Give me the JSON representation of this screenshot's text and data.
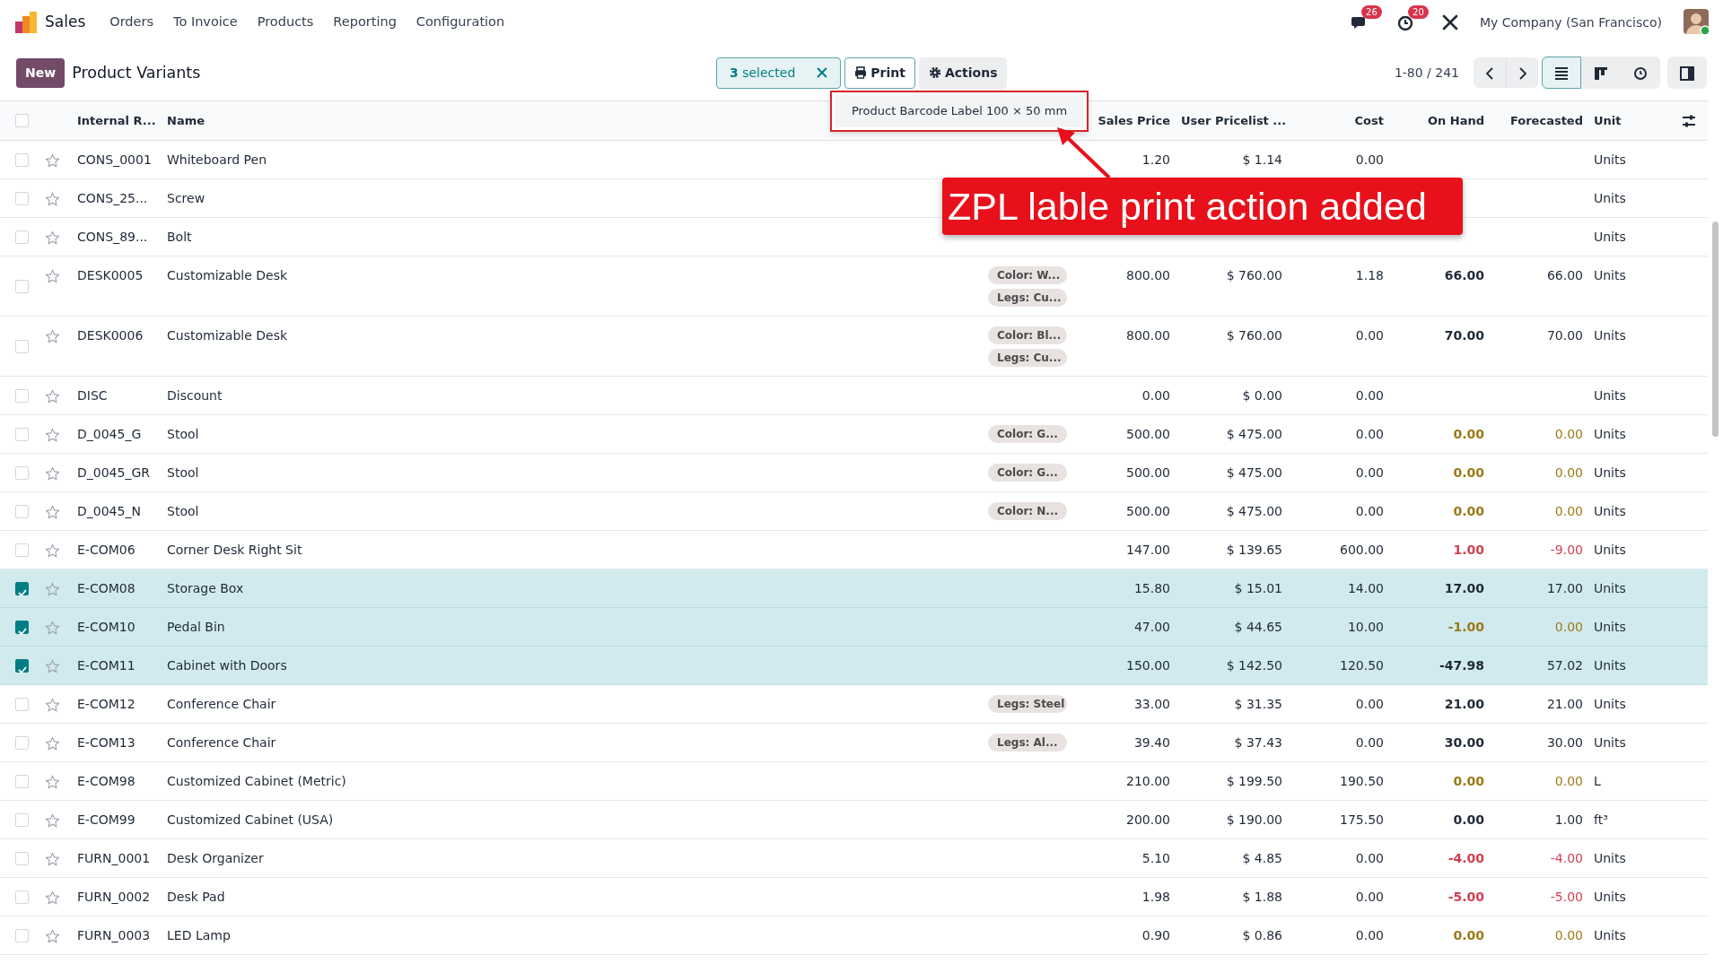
{
  "app": {
    "name": "Sales",
    "menu": [
      "Orders",
      "To Invoice",
      "Products",
      "Reporting",
      "Configuration"
    ]
  },
  "systray": {
    "messages_count": "26",
    "activities_count": "20",
    "company": "My Company (San Francisco)"
  },
  "control_panel": {
    "new_button": "New",
    "title": "Product Variants",
    "selection": "**3** selected",
    "print_button": "Print",
    "actions_button": "Actions",
    "pager": "1-80 / 241",
    "views": [
      {
        "kind": "list",
        "selected": true
      },
      {
        "kind": "kanban",
        "selected": false
      },
      {
        "kind": "activity",
        "selected": false
      }
    ]
  },
  "print_menu": {
    "items": [
      "Product Barcode Label 100 × 50 mm"
    ]
  },
  "annotation": {
    "text": "ZPL lable print action added"
  },
  "table": {
    "all_selected": false,
    "columns": [
      "Internal R...",
      "Name",
      "Sales Price",
      "User Pricelist ...",
      "Cost",
      "On Hand",
      "Forecasted",
      "Unit"
    ],
    "rows": [
      {
        "ref": "CONS_0001",
        "name": "Whiteboard Pen",
        "tags": [],
        "sales_price": "1.20",
        "pricelist_price": "$ 1.14",
        "cost": "0.00",
        "unit": "Units",
        "selected": false
      },
      {
        "ref": "CONS_25...",
        "name": "Screw",
        "tags": [],
        "unit": "Units",
        "selected": false
      },
      {
        "ref": "CONS_89...",
        "name": "Bolt",
        "tags": [],
        "unit": "Units",
        "selected": false
      },
      {
        "ref": "DESK0005",
        "name": "Customizable Desk",
        "tags": [
          "Color: W...",
          "Legs: Cu..."
        ],
        "sales_price": "800.00",
        "pricelist_price": "$ 760.00",
        "cost": "1.18",
        "on_hand": {
          "text": "66.00",
          "color": "#1f2937"
        },
        "forecasted": {
          "text": "66.00",
          "color": "#1f2937"
        },
        "unit": "Units",
        "selected": false
      },
      {
        "ref": "DESK0006",
        "name": "Customizable Desk",
        "tags": [
          "Color: Bl...",
          "Legs: Cu..."
        ],
        "sales_price": "800.00",
        "pricelist_price": "$ 760.00",
        "cost": "0.00",
        "on_hand": {
          "text": "70.00",
          "color": "#1f2937"
        },
        "forecasted": {
          "text": "70.00",
          "color": "#1f2937"
        },
        "unit": "Units",
        "selected": false
      },
      {
        "ref": "DISC",
        "name": "Discount",
        "tags": [],
        "sales_price": "0.00",
        "pricelist_price": "$ 0.00",
        "cost": "0.00",
        "unit": "Units",
        "selected": false
      },
      {
        "ref": "D_0045_G",
        "name": "Stool",
        "tags": [
          "Color: G..."
        ],
        "sales_price": "500.00",
        "pricelist_price": "$ 475.00",
        "cost": "0.00",
        "on_hand": {
          "text": "0.00",
          "color": "#9a7a16"
        },
        "forecasted": {
          "text": "0.00",
          "color": "#9a7a16"
        },
        "unit": "Units",
        "selected": false
      },
      {
        "ref": "D_0045_GR",
        "name": "Stool",
        "tags": [
          "Color: G..."
        ],
        "sales_price": "500.00",
        "pricelist_price": "$ 475.00",
        "cost": "0.00",
        "on_hand": {
          "text": "0.00",
          "color": "#9a7a16"
        },
        "forecasted": {
          "text": "0.00",
          "color": "#9a7a16"
        },
        "unit": "Units",
        "selected": false
      },
      {
        "ref": "D_0045_N",
        "name": "Stool",
        "tags": [
          "Color: N..."
        ],
        "sales_price": "500.00",
        "pricelist_price": "$ 475.00",
        "cost": "0.00",
        "on_hand": {
          "text": "0.00",
          "color": "#9a7a16"
        },
        "forecasted": {
          "text": "0.00",
          "color": "#9a7a16"
        },
        "unit": "Units",
        "selected": false
      },
      {
        "ref": "E-COM06",
        "name": "Corner Desk Right Sit",
        "tags": [],
        "sales_price": "147.00",
        "pricelist_price": "$ 139.65",
        "cost": "600.00",
        "on_hand": {
          "text": "1.00",
          "color": "#d23f4f"
        },
        "forecasted": {
          "text": "-9.00",
          "color": "#d23f4f"
        },
        "unit": "Units",
        "selected": false
      },
      {
        "ref": "E-COM08",
        "name": "Storage Box",
        "tags": [],
        "sales_price": "15.80",
        "pricelist_price": "$ 15.01",
        "cost": "14.00",
        "on_hand": {
          "text": "17.00",
          "color": "#1f2937"
        },
        "forecasted": {
          "text": "17.00",
          "color": "#1f2937"
        },
        "unit": "Units",
        "selected": true
      },
      {
        "ref": "E-COM10",
        "name": "Pedal Bin",
        "tags": [],
        "sales_price": "47.00",
        "pricelist_price": "$ 44.65",
        "cost": "10.00",
        "on_hand": {
          "text": "-1.00",
          "color": "#9a7a16"
        },
        "forecasted": {
          "text": "0.00",
          "color": "#9a7a16"
        },
        "unit": "Units",
        "selected": true
      },
      {
        "ref": "E-COM11",
        "name": "Cabinet with Doors",
        "tags": [],
        "sales_price": "150.00",
        "pricelist_price": "$ 142.50",
        "cost": "120.50",
        "on_hand": {
          "text": "-47.98",
          "color": "#1f2937"
        },
        "forecasted": {
          "text": "57.02",
          "color": "#1f2937"
        },
        "unit": "Units",
        "selected": true
      },
      {
        "ref": "E-COM12",
        "name": "Conference Chair",
        "tags": [
          "Legs: Steel"
        ],
        "sales_price": "33.00",
        "pricelist_price": "$ 31.35",
        "cost": "0.00",
        "on_hand": {
          "text": "21.00",
          "color": "#1f2937"
        },
        "forecasted": {
          "text": "21.00",
          "color": "#1f2937"
        },
        "unit": "Units",
        "selected": false
      },
      {
        "ref": "E-COM13",
        "name": "Conference Chair",
        "tags": [
          "Legs: Al..."
        ],
        "sales_price": "39.40",
        "pricelist_price": "$ 37.43",
        "cost": "0.00",
        "on_hand": {
          "text": "30.00",
          "color": "#1f2937"
        },
        "forecasted": {
          "text": "30.00",
          "color": "#1f2937"
        },
        "unit": "Units",
        "selected": false
      },
      {
        "ref": "E-COM98",
        "name": "Customized Cabinet (Metric)",
        "tags": [],
        "sales_price": "210.00",
        "pricelist_price": "$ 199.50",
        "cost": "190.50",
        "on_hand": {
          "text": "0.00",
          "color": "#9a7a16"
        },
        "forecasted": {
          "text": "0.00",
          "color": "#9a7a16"
        },
        "unit": "L",
        "selected": false
      },
      {
        "ref": "E-COM99",
        "name": "Customized Cabinet (USA)",
        "tags": [],
        "sales_price": "200.00",
        "pricelist_price": "$ 190.00",
        "cost": "175.50",
        "on_hand": {
          "text": "0.00",
          "color": "#1f2937"
        },
        "forecasted": {
          "text": "1.00",
          "color": "#1f2937"
        },
        "unit": "ft³",
        "selected": false
      },
      {
        "ref": "FURN_0001",
        "name": "Desk Organizer",
        "tags": [],
        "sales_price": "5.10",
        "pricelist_price": "$ 4.85",
        "cost": "0.00",
        "on_hand": {
          "text": "-4.00",
          "color": "#d23f4f"
        },
        "forecasted": {
          "text": "-4.00",
          "color": "#d23f4f"
        },
        "unit": "Units",
        "selected": false
      },
      {
        "ref": "FURN_0002",
        "name": "Desk Pad",
        "tags": [],
        "sales_price": "1.98",
        "pricelist_price": "$ 1.88",
        "cost": "0.00",
        "on_hand": {
          "text": "-5.00",
          "color": "#d23f4f"
        },
        "forecasted": {
          "text": "-5.00",
          "color": "#d23f4f"
        },
        "unit": "Units",
        "selected": false
      },
      {
        "ref": "FURN_0003",
        "name": "LED Lamp",
        "tags": [],
        "sales_price": "0.90",
        "pricelist_price": "$ 0.86",
        "cost": "0.00",
        "on_hand": {
          "text": "0.00",
          "color": "#9a7a16"
        },
        "forecasted": {
          "text": "0.00",
          "color": "#9a7a16"
        },
        "unit": "Units",
        "selected": false
      }
    ]
  }
}
